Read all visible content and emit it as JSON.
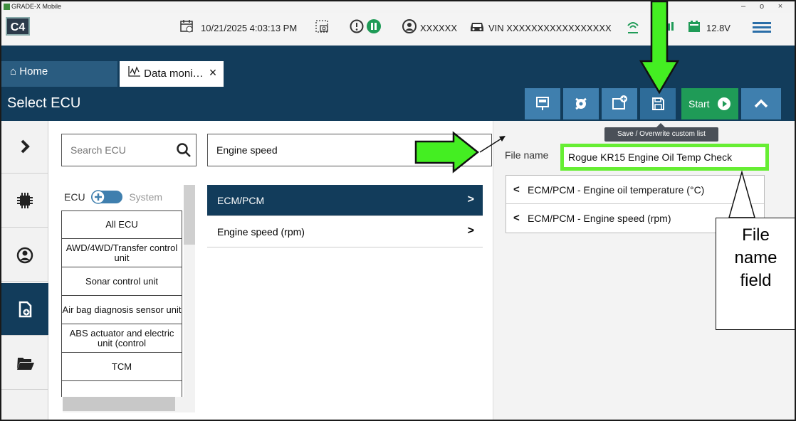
{
  "titlebar": {
    "app_name": "GRADE-X Mobile",
    "minimize": "–",
    "maximize": "o",
    "close": "×"
  },
  "status": {
    "logo": "C4",
    "datetime": "10/21/2025 4:03:13 PM",
    "user": "XXXXXX",
    "vin": "VIN XXXXXXXXXXXXXXXXX",
    "voltage": "12.8V"
  },
  "tabs": [
    {
      "label": "Home",
      "icon": "home-icon"
    },
    {
      "label": "Data moni…",
      "icon": "data-monitor-icon"
    }
  ],
  "header": {
    "title": "Select ECU",
    "start_label": "Start"
  },
  "tooltip": "Save / Overwrite custom list",
  "search": {
    "placeholder": "Search ECU"
  },
  "param_search": {
    "value": "Engine speed"
  },
  "ecu_toggle": {
    "left": "ECU",
    "right": "System"
  },
  "ecu_list": [
    "All ECU",
    "AWD/4WD/Transfer control unit",
    "Sonar control unit",
    "Air bag diagnosis sensor unit",
    "ABS actuator and electric unit (control",
    "TCM"
  ],
  "mid_list": [
    {
      "label": "ECM/PCM",
      "selected": true
    },
    {
      "label": "Engine speed (rpm)",
      "selected": false
    }
  ],
  "file": {
    "label": "File name",
    "value": "Rogue KR15 Engine Oil Temp Check"
  },
  "selected_params": [
    "ECM/PCM - Engine oil temperature (°C)",
    "ECM/PCM - Engine speed (rpm)"
  ],
  "callout": {
    "line1": "File",
    "line2": "name",
    "line3": "field"
  },
  "colors": {
    "navy": "#123c5b",
    "button_blue": "#3f7fae",
    "start_green": "#1f9b57",
    "highlight": "#66ee33"
  }
}
